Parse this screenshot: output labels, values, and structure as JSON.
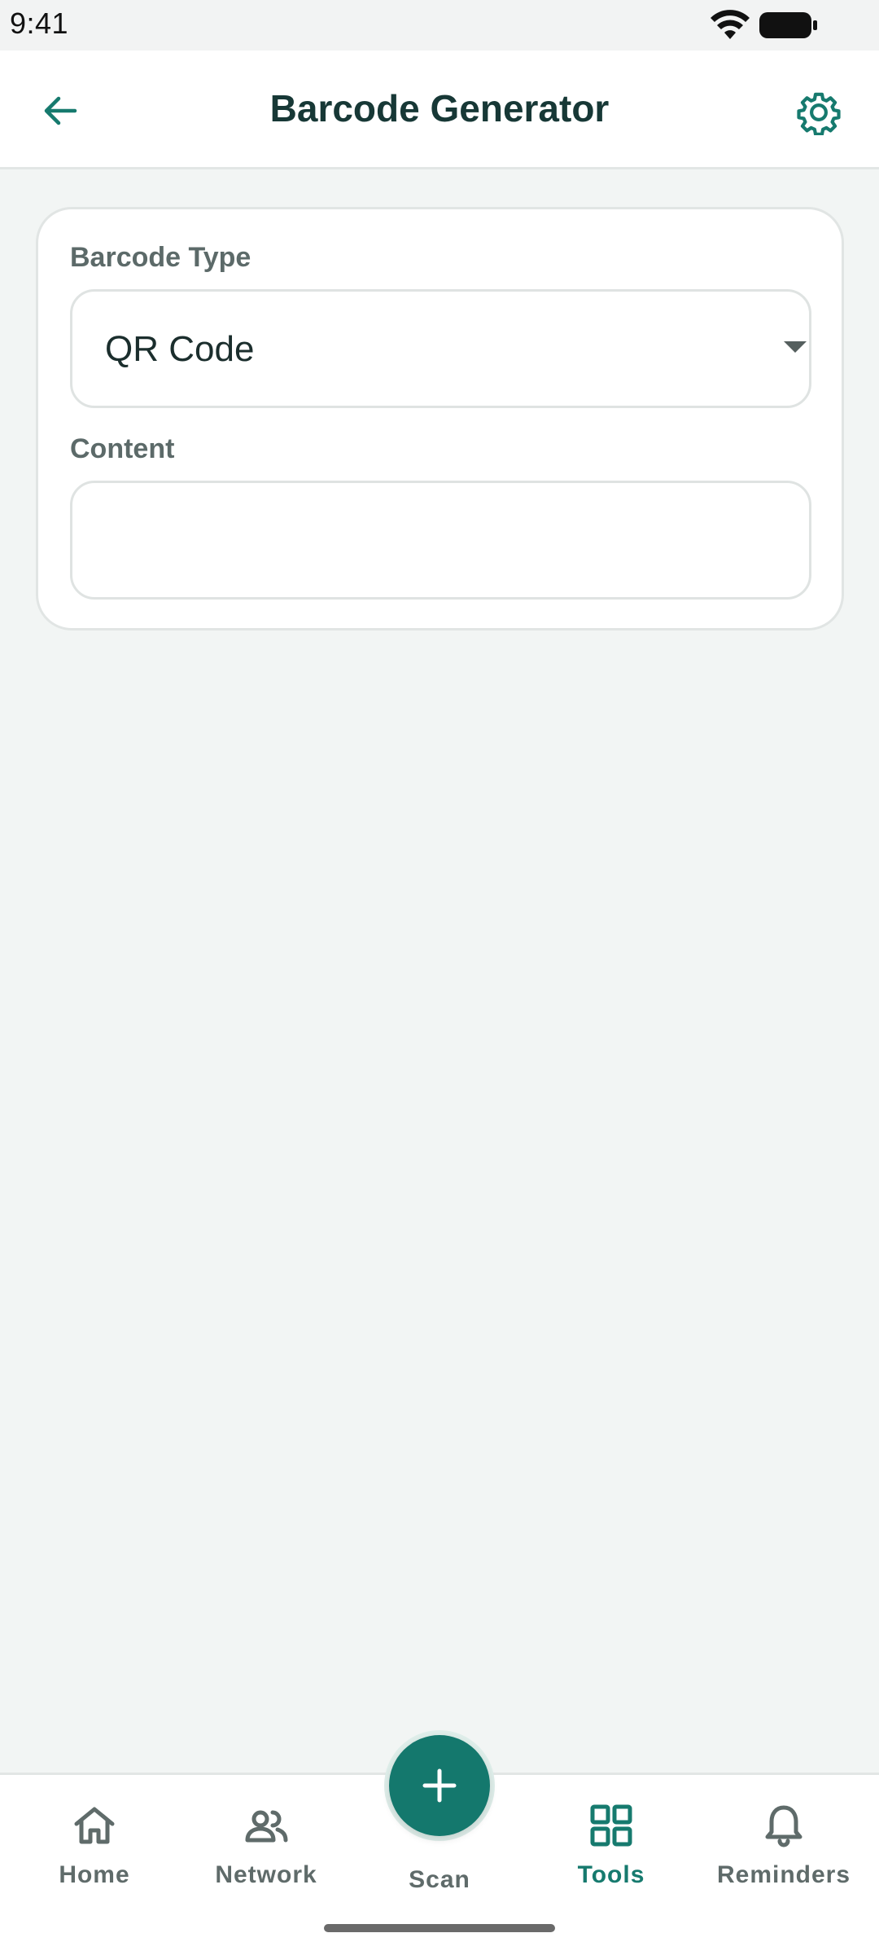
{
  "status_bar": {
    "time": "9:41"
  },
  "app_bar": {
    "title": "Barcode Generator",
    "back_icon": "arrow-left-icon",
    "settings_icon": "gear-icon"
  },
  "form": {
    "barcode_type_label": "Barcode Type",
    "barcode_type_value": "QR Code",
    "content_label": "Content",
    "content_value": "",
    "content_placeholder": ""
  },
  "bottom_nav": {
    "items": [
      {
        "label": "Home",
        "icon": "home-icon",
        "active": false
      },
      {
        "label": "Network",
        "icon": "people-icon",
        "active": false
      },
      {
        "label": "Scan",
        "icon": "plus-icon",
        "active": false
      },
      {
        "label": "Tools",
        "icon": "grid-icon",
        "active": true
      },
      {
        "label": "Reminders",
        "icon": "bell-icon",
        "active": false
      }
    ]
  },
  "colors": {
    "accent": "#14786d",
    "title": "#173836",
    "background": "#f2f5f4",
    "inactive_nav": "#5f6b6a"
  }
}
